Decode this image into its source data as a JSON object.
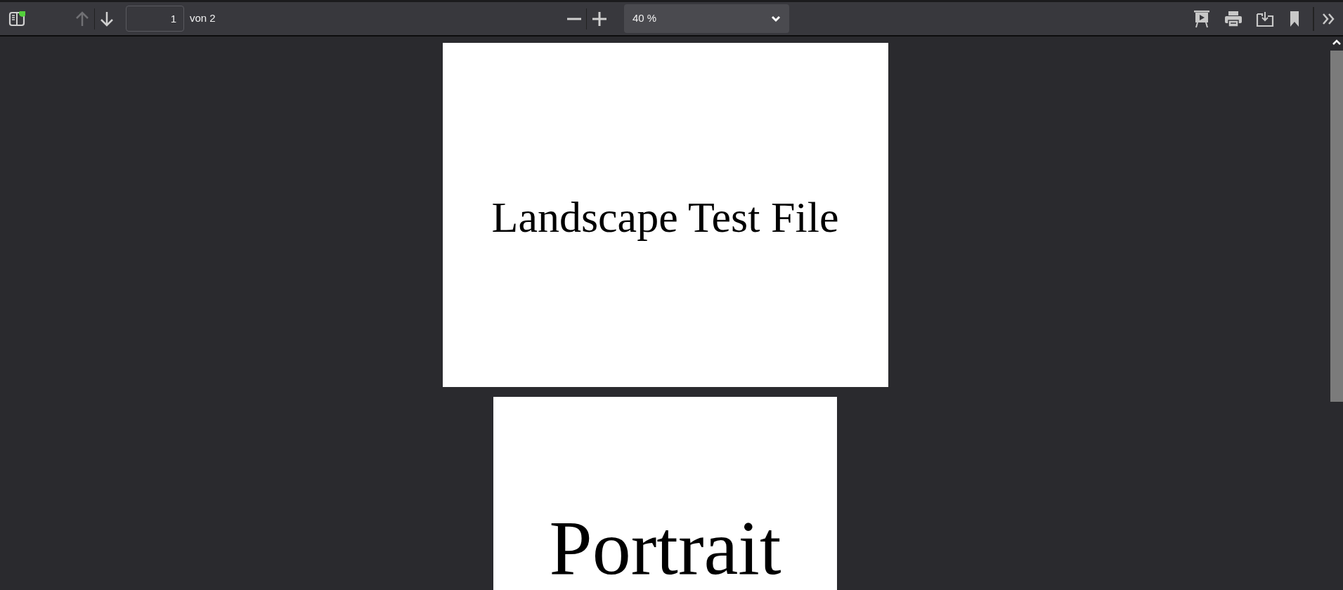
{
  "toolbar": {
    "nav_buttons": [
      {
        "kind": "up",
        "disabled": true
      },
      {
        "kind": "down",
        "disabled": false
      }
    ],
    "page_number": "1",
    "page_count": "von 2",
    "zoom": "40 %"
  },
  "pages": [
    {
      "kind": "landscape",
      "text": "Landscape Test File"
    },
    {
      "kind": "portrait",
      "text": "Portrait"
    }
  ]
}
